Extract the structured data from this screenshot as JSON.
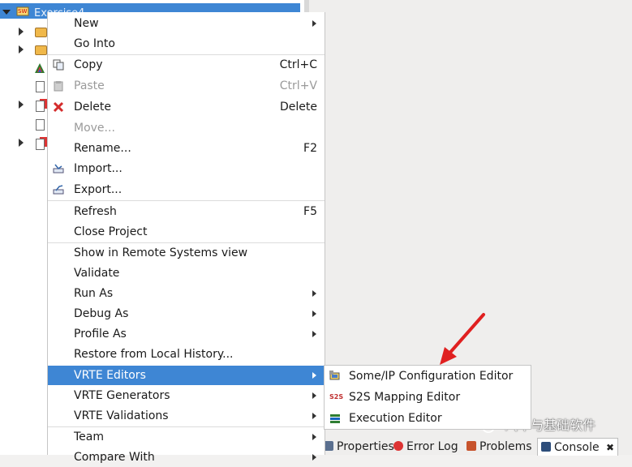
{
  "tree": {
    "root_label": "Exercise4",
    "root_icon": "project-icon",
    "children_icons": [
      "folder-icon",
      "folder-icon",
      "arxml-icon",
      "c-file-icon",
      "red-file-icon",
      "text-file-icon",
      "red-file-icon"
    ]
  },
  "menu": {
    "items": [
      {
        "label": "New",
        "accel": "",
        "submenu": true
      },
      {
        "label": "Go Into",
        "accel": ""
      },
      {
        "label": "Copy",
        "accel": "Ctrl+C",
        "icon": "copy-icon"
      },
      {
        "label": "Paste",
        "accel": "Ctrl+V",
        "icon": "paste-icon",
        "disabled": true
      },
      {
        "label": "Delete",
        "accel": "Delete",
        "icon": "delete-icon"
      },
      {
        "label": "Move...",
        "accel": "",
        "disabled": true
      },
      {
        "label": "Rename...",
        "accel": "F2"
      },
      {
        "label": "Import...",
        "accel": "",
        "icon": "import-icon"
      },
      {
        "label": "Export...",
        "accel": "",
        "icon": "export-icon"
      },
      {
        "label": "Refresh",
        "accel": "F5"
      },
      {
        "label": "Close Project",
        "accel": ""
      },
      {
        "label": "Show in Remote Systems view",
        "accel": ""
      },
      {
        "label": "Validate",
        "accel": ""
      },
      {
        "label": "Run As",
        "accel": "",
        "submenu": true
      },
      {
        "label": "Debug As",
        "accel": "",
        "submenu": true
      },
      {
        "label": "Profile As",
        "accel": "",
        "submenu": true
      },
      {
        "label": "Restore from Local History...",
        "accel": ""
      },
      {
        "label": "VRTE Editors",
        "accel": "",
        "submenu": true,
        "highlighted": true
      },
      {
        "label": "VRTE Generators",
        "accel": "",
        "submenu": true
      },
      {
        "label": "VRTE Validations",
        "accel": "",
        "submenu": true
      },
      {
        "label": "Team",
        "accel": "",
        "submenu": true
      },
      {
        "label": "Compare With",
        "accel": "",
        "submenu": true
      }
    ]
  },
  "submenu": {
    "items": [
      {
        "label": "Some/IP Configuration Editor",
        "icon": "someip-editor-icon"
      },
      {
        "label": "S2S Mapping Editor",
        "icon": "s2s-icon",
        "icon_text": "S2S"
      },
      {
        "label": "Execution Editor",
        "icon": "execution-editor-icon"
      }
    ]
  },
  "bottom_tabs": {
    "properties": "Properties",
    "error_log": "Error Log",
    "problems": "Problems",
    "console": "Console"
  },
  "watermark": {
    "text": "汽车与基础软件"
  },
  "colors": {
    "selection": "#3e86d4",
    "arrow": "#e02020"
  }
}
